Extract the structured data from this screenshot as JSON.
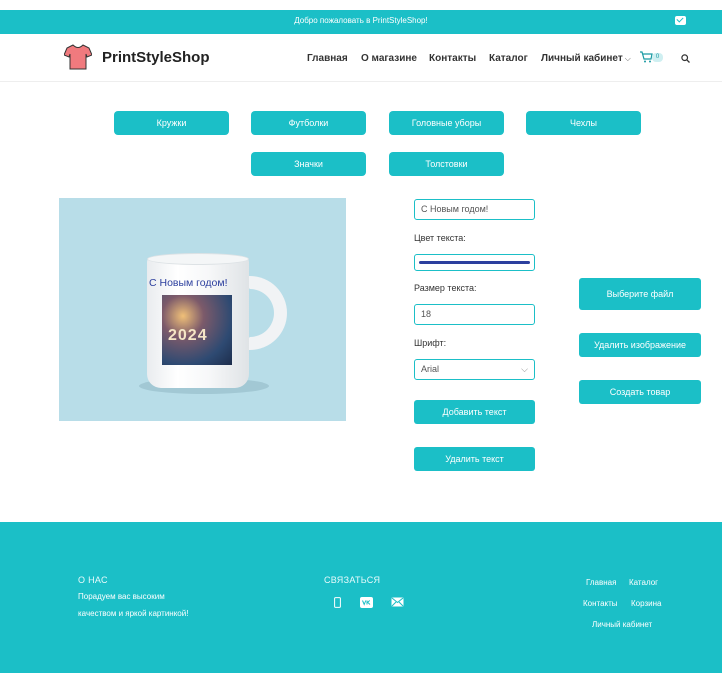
{
  "topbar": {
    "welcome": "Добро пожаловать в PrintStyleShop!"
  },
  "header": {
    "brand": "PrintStyleShop",
    "nav": [
      "Главная",
      "О магазине",
      "Контакты",
      "Каталог",
      "Личный кабинет"
    ],
    "cart_count": "0"
  },
  "categories": [
    "Кружки",
    "Футболки",
    "Головные уборы",
    "Чехлы",
    "Значки",
    "Толстовки"
  ],
  "preview": {
    "mug_text": "С Новым годом!",
    "photo_text": "2024",
    "text_color": "#2c3f9e"
  },
  "form": {
    "text_value": "С Новым годом!",
    "color_label": "Цвет текста:",
    "size_label": "Размер текста:",
    "size_value": "18",
    "font_label": "Шрифт:",
    "font_value": "Arial",
    "add_text": "Добавить текст",
    "remove_text": "Удалить текст"
  },
  "actions": {
    "choose_file": "Выберите файл",
    "remove_image": "Удалить изображение",
    "create_product": "Создать товар"
  },
  "footer": {
    "about_title": "О НАС",
    "about_text": "Порадуем вас высоким качеством и яркой картинкой!",
    "contact_title": "СВЯЗАТЬСЯ",
    "links": [
      "Главная",
      "Каталог",
      "Контакты",
      "Корзина",
      "Личный кабинет"
    ]
  },
  "colors": {
    "accent": "#1bbfc7",
    "text_blue": "#2c3f9e"
  }
}
